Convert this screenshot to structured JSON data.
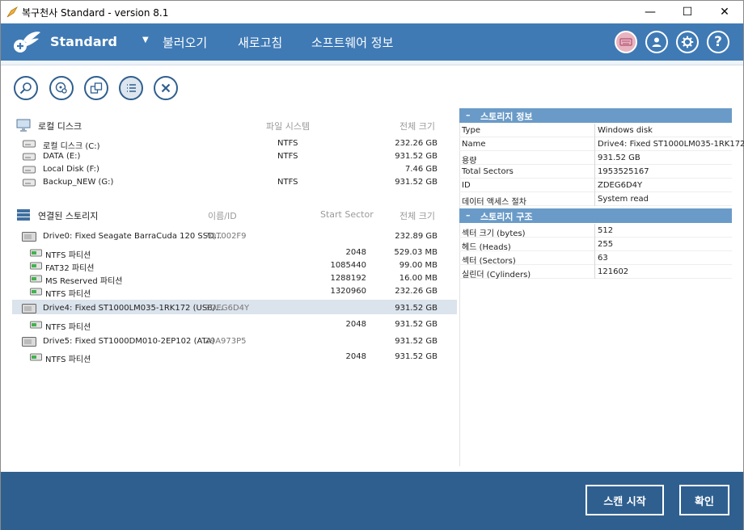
{
  "window": {
    "title": "복구천사 Standard - version 8.1",
    "min_glyph": "—",
    "max_glyph": "☐",
    "close_glyph": "✕"
  },
  "header": {
    "brand": "Standard",
    "caret": "▼",
    "menu": [
      "불러오기",
      "새로고침",
      "소프트웨어 정보"
    ],
    "help_glyph": "?"
  },
  "local": {
    "title": "로컬 디스크",
    "col_fs": "파일 시스템",
    "col_size": "전체 크기",
    "items": [
      {
        "name": "로컬 디스크 (C:)",
        "fs": "NTFS",
        "size": "232.26 GB"
      },
      {
        "name": "DATA (E:)",
        "fs": "NTFS",
        "size": "931.52 GB"
      },
      {
        "name": "Local Disk (F:)",
        "fs": "",
        "size": "7.46 GB"
      },
      {
        "name": "Backup_NEW (G:)",
        "fs": "NTFS",
        "size": "931.52 GB"
      }
    ]
  },
  "storage": {
    "title": "연결된 스토리지",
    "col_id": "이름/ID",
    "col_start": "Start Sector",
    "col_size": "전체 크기",
    "drive0": {
      "name": "Drive0: Fixed Seagate BarraCuda 120 SSD...",
      "id": "7QT002F9",
      "size": "232.89 GB"
    },
    "drive0_parts": [
      {
        "name": "NTFS 파티션",
        "start": "2048",
        "size": "529.03 MB"
      },
      {
        "name": "FAT32 파티션",
        "start": "1085440",
        "size": "99.00 MB"
      },
      {
        "name": "MS Reserved 파티션",
        "start": "1288192",
        "size": "16.00 MB"
      },
      {
        "name": "NTFS 파티션",
        "start": "1320960",
        "size": "232.26 GB"
      }
    ],
    "drive4": {
      "name": "Drive4: Fixed ST1000LM035-1RK172 (USB/...",
      "id": "ZDEG6D4Y",
      "size": "931.52 GB"
    },
    "drive4_parts": [
      {
        "name": "NTFS 파티션",
        "start": "2048",
        "size": "931.52 GB"
      }
    ],
    "drive5": {
      "name": "Drive5: Fixed ST1000DM010-2EP102 (ATA)",
      "id": "Z9A973P5",
      "size": "931.52 GB"
    },
    "drive5_parts": [
      {
        "name": "NTFS 파티션",
        "start": "2048",
        "size": "931.52 GB"
      }
    ]
  },
  "info": {
    "title": "스토리지 정보",
    "toggle": "–",
    "rows": [
      {
        "k": "Type",
        "v": "Windows disk"
      },
      {
        "k": "Name",
        "v": "Drive4: Fixed ST1000LM035-1RK172"
      },
      {
        "k": "용량",
        "v": "931.52 GB"
      },
      {
        "k": "Total Sectors",
        "v": "1953525167"
      },
      {
        "k": "ID",
        "v": "ZDEG6D4Y"
      },
      {
        "k": "데이터 액세스 절차",
        "v": "System read"
      }
    ]
  },
  "structure": {
    "title": "스토리지 구조",
    "toggle": "–",
    "rows": [
      {
        "k": "섹터 크기 (bytes)",
        "v": "512"
      },
      {
        "k": "헤드 (Heads)",
        "v": "255"
      },
      {
        "k": "섹터 (Sectors)",
        "v": "63"
      },
      {
        "k": "실린더 (Cylinders)",
        "v": "121602"
      }
    ]
  },
  "footer": {
    "scan": "스캔 시작",
    "ok": "확인"
  },
  "colors": {
    "header": "#3f7ab5",
    "footer": "#2f5f8f",
    "panel_head": "#6a9bc8",
    "selected_row": "#dbe3ec"
  }
}
